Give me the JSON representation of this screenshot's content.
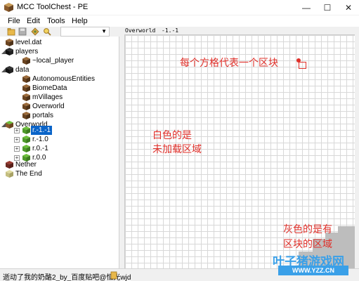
{
  "window": {
    "title": "MCC ToolChest - PE",
    "minimize": "—",
    "maximize": "☐",
    "close": "✕"
  },
  "menu": [
    "File",
    "Edit",
    "Tools",
    "Help"
  ],
  "tree": {
    "level_dat": "level.dat",
    "players": "players",
    "local_player": "~local_player",
    "data": "data",
    "autonomous": "AutonomousEntities",
    "biome": "BiomeData",
    "villages": "mVillages",
    "overworld_data": "Overworld",
    "portals": "portals",
    "overworld": "Overworld",
    "r1": "r.-1.-1",
    "r2": "r.-1.0",
    "r3": "r.0.-1",
    "r4": "r.0.0",
    "nether": "Nether",
    "end": "The End"
  },
  "main": {
    "header_dim": "Overworld",
    "header_coords": "-1.-1"
  },
  "annotations": {
    "per_square": "每个方格代表一个区块",
    "white_1": "白色的是",
    "white_2": "未加载区域",
    "gray_1": "灰色的是有",
    "gray_2": "区块的区域"
  },
  "status": {
    "text": "逝动了我的奶酪2_by_百度贴吧@恒光wjd"
  },
  "watermark": {
    "main": "叶子猪游戏网",
    "url": "WWW.YZZ.CN"
  }
}
